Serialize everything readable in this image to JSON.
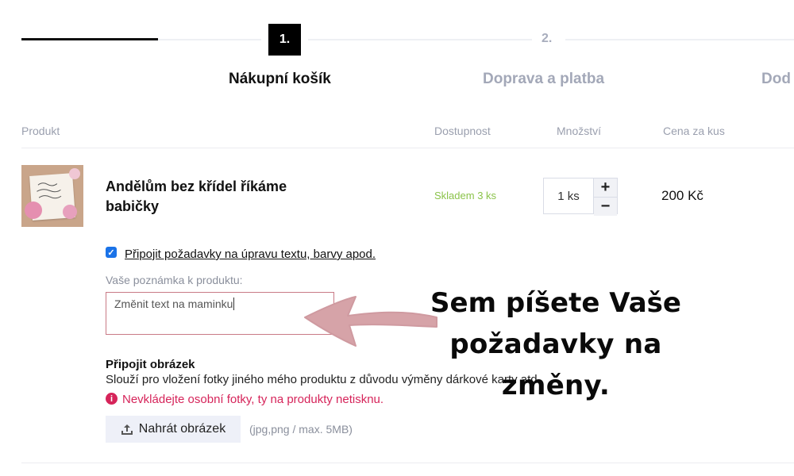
{
  "stepper": {
    "step1_num": "1.",
    "step1_label": "Nákupní košík",
    "step2_num": "2.",
    "step2_label": "Doprava a platba",
    "step3_label": "Dod"
  },
  "table_header": {
    "product": "Produkt",
    "availability": "Dostupnost",
    "quantity": "Množství",
    "unit_price": "Cena za kus"
  },
  "item": {
    "name": "Andělům bez křídel říkáme babičky",
    "stock": "Skladem 3 ks",
    "quantity": "1 ks",
    "price": "200 Kč"
  },
  "options": {
    "checkbox_label": "Připojit požadavky na úpravu textu, barvy apod.",
    "note_label": "Vaše poznámka k produktu:",
    "note_value": "Změnit text na maminku",
    "attach_title": "Připojit obrázek",
    "attach_desc": "Slouží pro vložení fotky jiného mého produktu z důvodu výměny dárkové karty atd.",
    "warning": "Nevkládejte osobní fotky, ty na produkty netisknu.",
    "upload_label": "Nahrát obrázek",
    "upload_hint": "(jpg,png / max. 5MB)"
  },
  "annotation": {
    "line1": "Sem píšete Vaše",
    "line2": "požadavky na změny."
  },
  "colors": {
    "stock_green": "#8bc34a",
    "warning_red": "#d6245a",
    "arrow_pink": "#d6a3a8"
  }
}
